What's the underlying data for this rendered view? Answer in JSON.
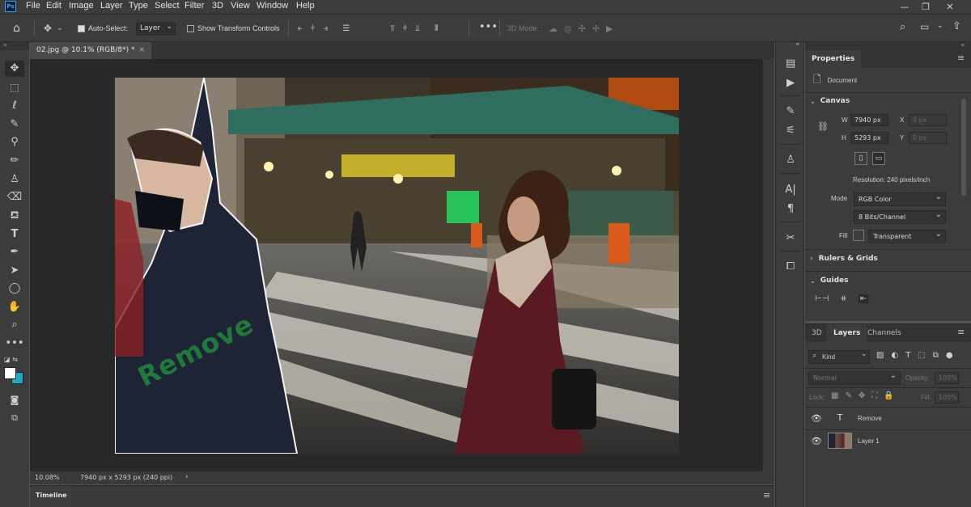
{
  "app": {
    "logo": "Ps"
  },
  "menu": [
    "File",
    "Edit",
    "Image",
    "Layer",
    "Type",
    "Select",
    "Filter",
    "3D",
    "View",
    "Window",
    "Help"
  ],
  "window_controls": {
    "minimize": "—",
    "restore": "❐",
    "close": "✕"
  },
  "options": {
    "auto_select_label": "Auto-Select:",
    "auto_select_value": "Layer",
    "transform_label": "Show Transform Controls",
    "mode_3d_label": "3D Mode:"
  },
  "document": {
    "tab_title": "02.jpg @ 10.1% (RGB/8*) *",
    "zoom": "10.08%",
    "info": "7940 px x 5293 px (240 ppi)",
    "overlay_text": "Remove",
    "overlay_color": "#1f7a3a"
  },
  "timeline": {
    "label": "Timeline"
  },
  "properties": {
    "tab": "Properties",
    "doc_label": "Document",
    "canvas_section": "Canvas",
    "w_label": "W",
    "w_value": "7940 px",
    "h_label": "H",
    "h_value": "5293 px",
    "x_label": "X",
    "x_value": "0 px",
    "y_label": "Y",
    "y_value": "0 px",
    "resolution": "Resolution: 240 pixels/inch",
    "mode_label": "Mode",
    "mode_value": "RGB Color",
    "bits_value": "8 Bits/Channel",
    "fill_label": "Fill",
    "fill_value": "Transparent",
    "rulers_section": "Rulers & Grids",
    "guides_section": "Guides"
  },
  "layers_panel": {
    "tabs": [
      "3D",
      "Layers",
      "Channels"
    ],
    "kind_label": "Kind",
    "blend_mode": "Normal",
    "opacity_label": "Opacity:",
    "opacity_value": "100%",
    "lock_label": "Lock:",
    "fill_label": "Fill:",
    "fill_value": "100%",
    "layers": [
      {
        "name": "Remove",
        "type": "text"
      },
      {
        "name": "Layer 1",
        "type": "image"
      }
    ]
  },
  "colors": {
    "foreground": "#ffffff",
    "background": "#1fa8c8"
  }
}
